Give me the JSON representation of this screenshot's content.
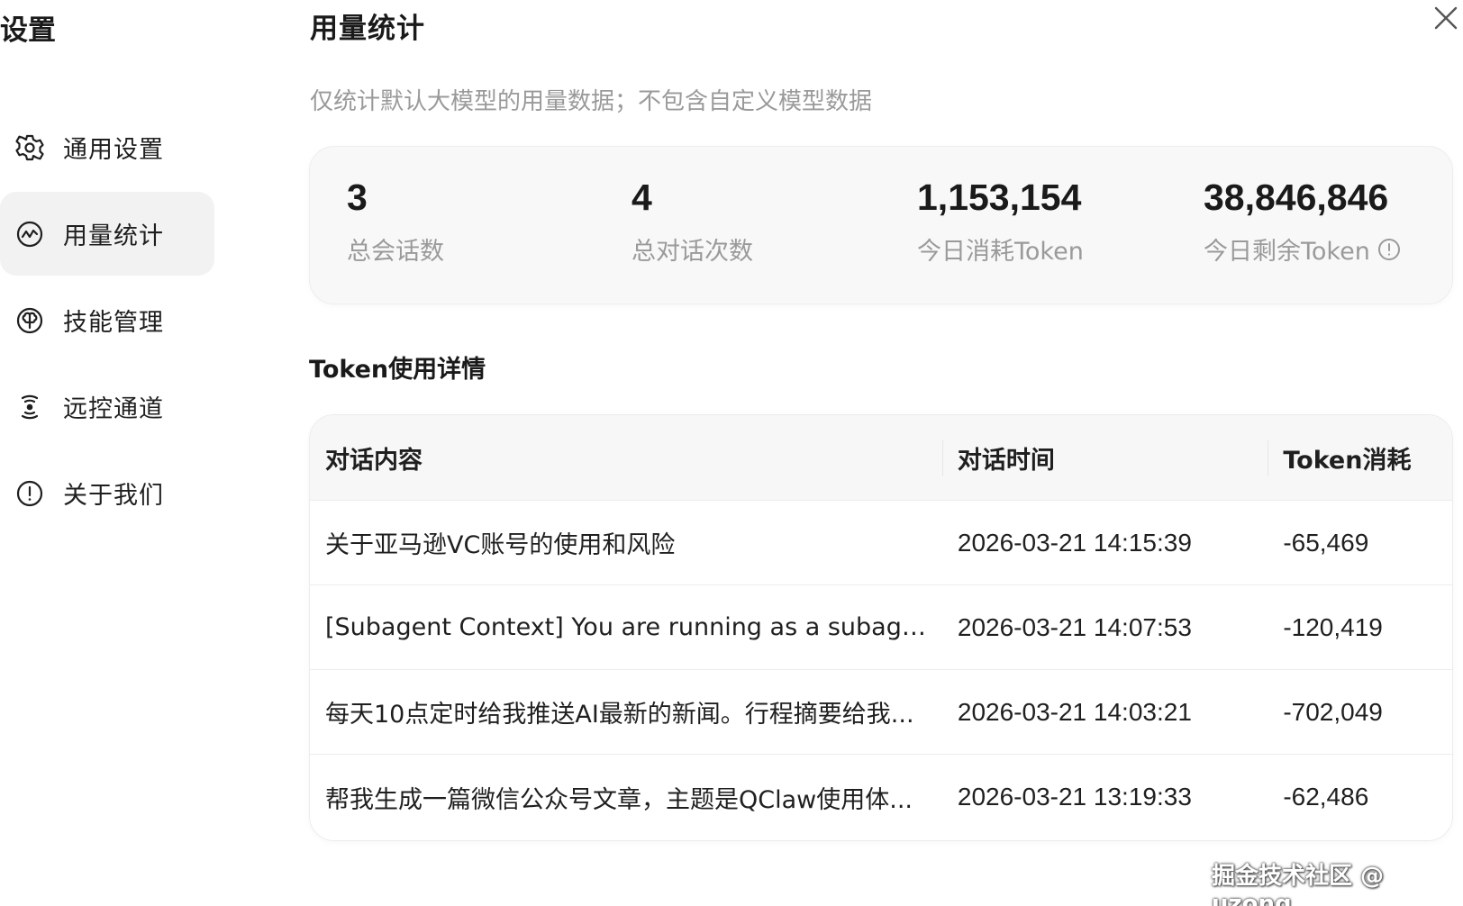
{
  "sidebar": {
    "title": "设置",
    "items": [
      {
        "label": "通用设置",
        "icon": "gear-icon"
      },
      {
        "label": "用量统计",
        "icon": "chart-line-icon",
        "active": true
      },
      {
        "label": "技能管理",
        "icon": "brain-icon"
      },
      {
        "label": "远控通道",
        "icon": "signal-icon"
      },
      {
        "label": "关于我们",
        "icon": "info-icon"
      }
    ]
  },
  "main": {
    "title": "用量统计",
    "subtitle": "仅统计默认大模型的用量数据；不包含自定义模型数据",
    "stats": [
      {
        "value": "3",
        "label": "总会话数"
      },
      {
        "value": "4",
        "label": "总对话次数"
      },
      {
        "value": "1,153,154",
        "label": "今日消耗Token"
      },
      {
        "value": "38,846,846",
        "label": "今日剩余Token"
      }
    ],
    "section_title": "Token使用详情",
    "table": {
      "headers": [
        "对话内容",
        "对话时间",
        "Token消耗"
      ],
      "rows": [
        [
          "关于亚马逊VC账号的使用和风险",
          "2026-03-21 14:15:39",
          "-65,469"
        ],
        [
          "[Subagent Context] You are running as a subagen...",
          "2026-03-21 14:07:53",
          "-120,419"
        ],
        [
          "每天10点定时给我推送AI最新的新闻。行程摘要给我...",
          "2026-03-21 14:03:21",
          "-702,049"
        ],
        [
          "帮我生成一篇微信公众号文章，主题是QClaw使用体...",
          "2026-03-21 13:19:33",
          "-62,486"
        ]
      ]
    }
  },
  "watermark": "掘金技术社区 @ uzong",
  "colors": {
    "active_bg": "#f2f2f3",
    "card_bg": "#f8f8f9",
    "muted_text": "#9a9a9a",
    "primary_text": "#1a1a1a"
  }
}
